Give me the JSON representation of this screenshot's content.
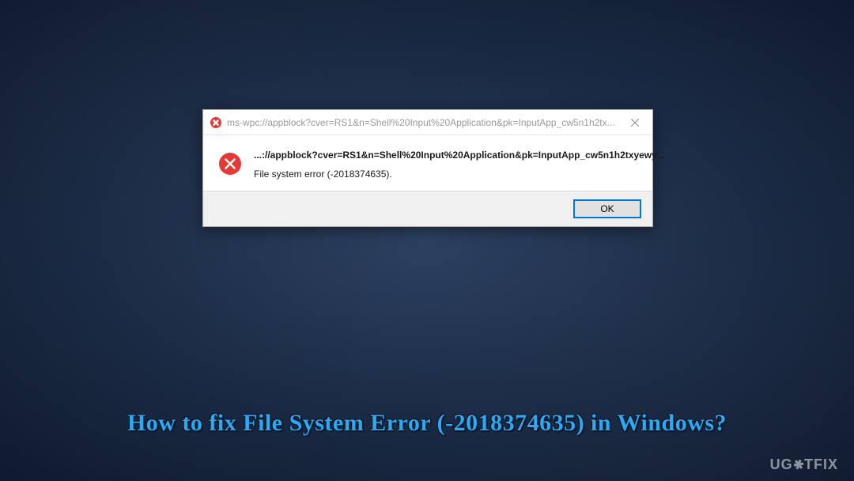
{
  "dialog": {
    "titlebar": {
      "icon_name": "error-icon",
      "text": "ms-wpc://appblock?cver=RS1&n=Shell%20Input%20Application&pk=InputApp_cw5n1h2tx...",
      "close_label": "Close"
    },
    "body": {
      "icon_name": "error-icon",
      "primary_text": "...://appblock?cver=RS1&n=Shell%20Input%20Application&pk=InputApp_cw5n1h2txyewy...",
      "secondary_text": "File system error (-2018374635)."
    },
    "footer": {
      "ok_label": "OK"
    }
  },
  "caption": "How to fix File System Error (-2018374635) in Windows?",
  "watermark": "UG⚙TFIX"
}
